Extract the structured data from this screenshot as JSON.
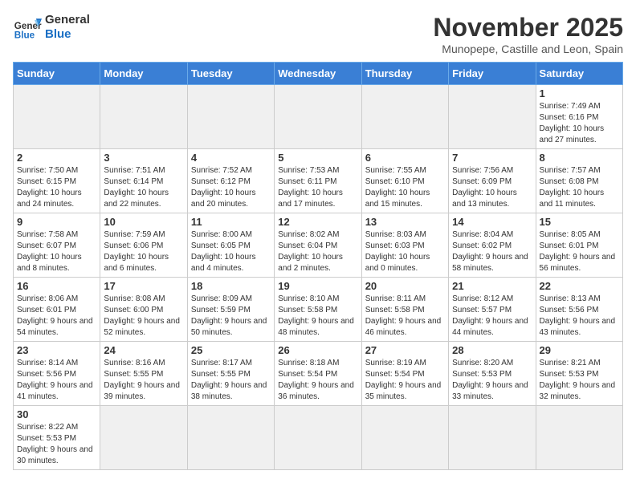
{
  "header": {
    "logo_general": "General",
    "logo_blue": "Blue",
    "month": "November 2025",
    "location": "Munopepe, Castille and Leon, Spain"
  },
  "weekdays": [
    "Sunday",
    "Monday",
    "Tuesday",
    "Wednesday",
    "Thursday",
    "Friday",
    "Saturday"
  ],
  "weeks": [
    [
      {
        "day": "",
        "info": ""
      },
      {
        "day": "",
        "info": ""
      },
      {
        "day": "",
        "info": ""
      },
      {
        "day": "",
        "info": ""
      },
      {
        "day": "",
        "info": ""
      },
      {
        "day": "",
        "info": ""
      },
      {
        "day": "1",
        "info": "Sunrise: 7:49 AM\nSunset: 6:16 PM\nDaylight: 10 hours and 27 minutes."
      }
    ],
    [
      {
        "day": "2",
        "info": "Sunrise: 7:50 AM\nSunset: 6:15 PM\nDaylight: 10 hours and 24 minutes."
      },
      {
        "day": "3",
        "info": "Sunrise: 7:51 AM\nSunset: 6:14 PM\nDaylight: 10 hours and 22 minutes."
      },
      {
        "day": "4",
        "info": "Sunrise: 7:52 AM\nSunset: 6:12 PM\nDaylight: 10 hours and 20 minutes."
      },
      {
        "day": "5",
        "info": "Sunrise: 7:53 AM\nSunset: 6:11 PM\nDaylight: 10 hours and 17 minutes."
      },
      {
        "day": "6",
        "info": "Sunrise: 7:55 AM\nSunset: 6:10 PM\nDaylight: 10 hours and 15 minutes."
      },
      {
        "day": "7",
        "info": "Sunrise: 7:56 AM\nSunset: 6:09 PM\nDaylight: 10 hours and 13 minutes."
      },
      {
        "day": "8",
        "info": "Sunrise: 7:57 AM\nSunset: 6:08 PM\nDaylight: 10 hours and 11 minutes."
      }
    ],
    [
      {
        "day": "9",
        "info": "Sunrise: 7:58 AM\nSunset: 6:07 PM\nDaylight: 10 hours and 8 minutes."
      },
      {
        "day": "10",
        "info": "Sunrise: 7:59 AM\nSunset: 6:06 PM\nDaylight: 10 hours and 6 minutes."
      },
      {
        "day": "11",
        "info": "Sunrise: 8:00 AM\nSunset: 6:05 PM\nDaylight: 10 hours and 4 minutes."
      },
      {
        "day": "12",
        "info": "Sunrise: 8:02 AM\nSunset: 6:04 PM\nDaylight: 10 hours and 2 minutes."
      },
      {
        "day": "13",
        "info": "Sunrise: 8:03 AM\nSunset: 6:03 PM\nDaylight: 10 hours and 0 minutes."
      },
      {
        "day": "14",
        "info": "Sunrise: 8:04 AM\nSunset: 6:02 PM\nDaylight: 9 hours and 58 minutes."
      },
      {
        "day": "15",
        "info": "Sunrise: 8:05 AM\nSunset: 6:01 PM\nDaylight: 9 hours and 56 minutes."
      }
    ],
    [
      {
        "day": "16",
        "info": "Sunrise: 8:06 AM\nSunset: 6:01 PM\nDaylight: 9 hours and 54 minutes."
      },
      {
        "day": "17",
        "info": "Sunrise: 8:08 AM\nSunset: 6:00 PM\nDaylight: 9 hours and 52 minutes."
      },
      {
        "day": "18",
        "info": "Sunrise: 8:09 AM\nSunset: 5:59 PM\nDaylight: 9 hours and 50 minutes."
      },
      {
        "day": "19",
        "info": "Sunrise: 8:10 AM\nSunset: 5:58 PM\nDaylight: 9 hours and 48 minutes."
      },
      {
        "day": "20",
        "info": "Sunrise: 8:11 AM\nSunset: 5:58 PM\nDaylight: 9 hours and 46 minutes."
      },
      {
        "day": "21",
        "info": "Sunrise: 8:12 AM\nSunset: 5:57 PM\nDaylight: 9 hours and 44 minutes."
      },
      {
        "day": "22",
        "info": "Sunrise: 8:13 AM\nSunset: 5:56 PM\nDaylight: 9 hours and 43 minutes."
      }
    ],
    [
      {
        "day": "23",
        "info": "Sunrise: 8:14 AM\nSunset: 5:56 PM\nDaylight: 9 hours and 41 minutes."
      },
      {
        "day": "24",
        "info": "Sunrise: 8:16 AM\nSunset: 5:55 PM\nDaylight: 9 hours and 39 minutes."
      },
      {
        "day": "25",
        "info": "Sunrise: 8:17 AM\nSunset: 5:55 PM\nDaylight: 9 hours and 38 minutes."
      },
      {
        "day": "26",
        "info": "Sunrise: 8:18 AM\nSunset: 5:54 PM\nDaylight: 9 hours and 36 minutes."
      },
      {
        "day": "27",
        "info": "Sunrise: 8:19 AM\nSunset: 5:54 PM\nDaylight: 9 hours and 35 minutes."
      },
      {
        "day": "28",
        "info": "Sunrise: 8:20 AM\nSunset: 5:53 PM\nDaylight: 9 hours and 33 minutes."
      },
      {
        "day": "29",
        "info": "Sunrise: 8:21 AM\nSunset: 5:53 PM\nDaylight: 9 hours and 32 minutes."
      }
    ],
    [
      {
        "day": "30",
        "info": "Sunrise: 8:22 AM\nSunset: 5:53 PM\nDaylight: 9 hours and 30 minutes."
      },
      {
        "day": "",
        "info": ""
      },
      {
        "day": "",
        "info": ""
      },
      {
        "day": "",
        "info": ""
      },
      {
        "day": "",
        "info": ""
      },
      {
        "day": "",
        "info": ""
      },
      {
        "day": "",
        "info": ""
      }
    ]
  ]
}
